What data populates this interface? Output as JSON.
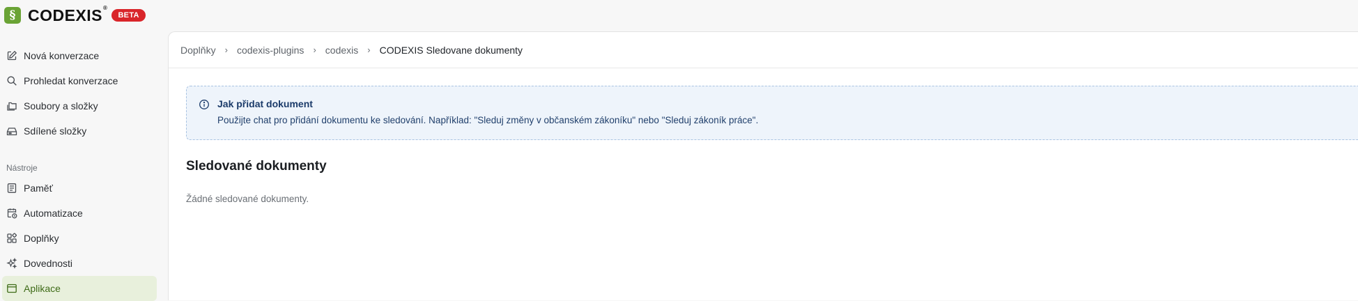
{
  "brand": {
    "name": "CODEXIS",
    "registered": "®",
    "badge": "BETA",
    "logo_glyph": "§",
    "logo_color": "#6aa335",
    "badge_color": "#d9252a"
  },
  "sidebar": {
    "items": [
      {
        "label": "Nová konverzace",
        "icon": "edit-icon"
      },
      {
        "label": "Prohledat konverzace",
        "icon": "search-icon"
      },
      {
        "label": "Soubory a složky",
        "icon": "folders-icon"
      },
      {
        "label": "Sdílené složky",
        "icon": "shared-drive-icon"
      }
    ],
    "tools_label": "Nástroje",
    "tools": [
      {
        "label": "Paměť",
        "icon": "memory-icon"
      },
      {
        "label": "Automatizace",
        "icon": "calendar-clock-icon"
      },
      {
        "label": "Doplňky",
        "icon": "plugins-icon"
      },
      {
        "label": "Dovednosti",
        "icon": "sparkles-icon"
      },
      {
        "label": "Aplikace",
        "icon": "app-window-icon",
        "active": true
      }
    ],
    "active_color": "#e8f0dc"
  },
  "breadcrumb": {
    "items": [
      "Doplňky",
      "codexis-plugins",
      "codexis",
      "CODEXIS Sledovane dokumenty"
    ]
  },
  "info": {
    "title": "Jak přidat dokument",
    "text": "Použijte chat pro přidání dokumentu ke sledování. Například: \"Sleduj změny v občanském zákoníku\" nebo \"Sleduj zákoník práce\".",
    "icon": "info-icon",
    "bg_color": "#eef4fb"
  },
  "main": {
    "section_title": "Sledované dokumenty",
    "empty_text": "Žádné sledované dokumenty."
  }
}
